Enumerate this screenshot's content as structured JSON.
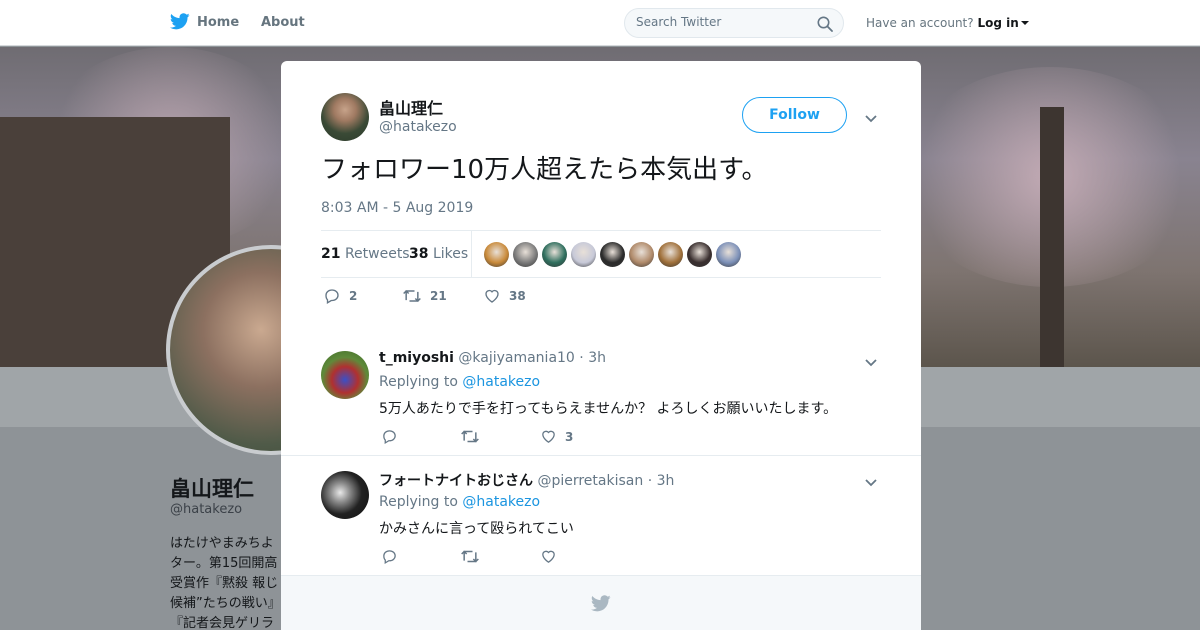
{
  "header": {
    "nav_home": "Home",
    "nav_about": "About",
    "search_placeholder": "Search Twitter",
    "account_prompt": "Have an account?",
    "login_label": "Log in"
  },
  "profile": {
    "name": "畠山理仁",
    "handle": "@hatakezo",
    "bio_lines": [
      "はたけやまみちよ",
      "ター。第15回開高",
      "受賞作『黙殺 報じ",
      "候補”たちの戦い』",
      "『記者会見ゲリラ"
    ]
  },
  "tweet": {
    "author_name": "畠山理仁",
    "author_handle": "@hatakezo",
    "follow_label": "Follow",
    "text": "フォロワー10万人超えたら本気出す。",
    "timestamp": "8:03 AM - 5 Aug 2019",
    "retweets_count": "21",
    "retweets_label": "Retweets",
    "likes_count": "38",
    "likes_label": "Likes",
    "action_reply_count": "2",
    "action_retweet_count": "21",
    "action_like_count": "38",
    "liker_avatar_colors": [
      "#c98a3a",
      "#7b7b7b",
      "#2f6f5e",
      "#c7c9d8",
      "#2b2b2b",
      "#b08a6a",
      "#a0703a",
      "#3a2f2f",
      "#7c90b8"
    ]
  },
  "replies": [
    {
      "name": "t_miyoshi",
      "handle": "@kajiyamania10",
      "time": "3h",
      "replying_prefix": "Replying to",
      "replying_to": "@hatakezo",
      "text": "5万人あたりで手を打ってもらえませんか？ よろしくお願いいたします。",
      "like_count": "3"
    },
    {
      "name": "フォートナイトおじさん",
      "handle": "@pierretakisan",
      "time": "3h",
      "replying_prefix": "Replying to",
      "replying_to": "@hatakezo",
      "text": "かみさんに言って殴られてこい",
      "like_count": ""
    }
  ],
  "colors": {
    "twitter_blue": "#1da1f2",
    "link_blue": "#1b95e0",
    "secondary_text": "#657786"
  }
}
